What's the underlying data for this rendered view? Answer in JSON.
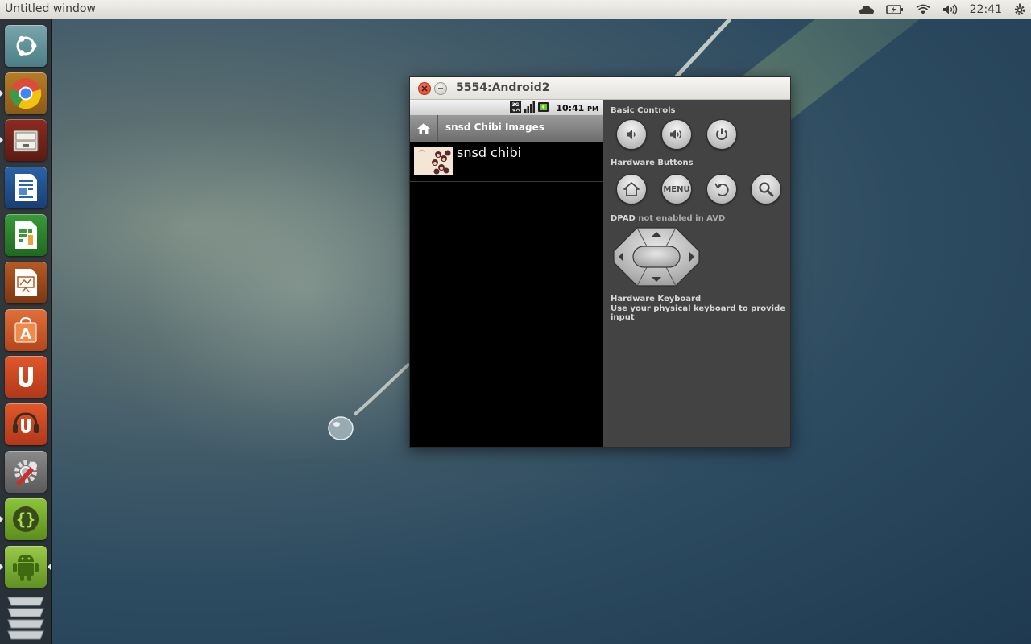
{
  "panel": {
    "window_title": "Untitled window",
    "clock": "22:41",
    "tray_icons": [
      "cloud-icon",
      "battery-icon",
      "wifi-icon",
      "volume-icon",
      "power-gear-icon"
    ]
  },
  "launcher": {
    "items": [
      {
        "name": "ubuntu-dash-icon"
      },
      {
        "name": "chrome-icon"
      },
      {
        "name": "file-manager-icon"
      },
      {
        "name": "writer-icon"
      },
      {
        "name": "calc-icon"
      },
      {
        "name": "impress-icon"
      },
      {
        "name": "software-center-icon"
      },
      {
        "name": "ubuntu-one-icon"
      },
      {
        "name": "ubuntu-one-music-icon"
      },
      {
        "name": "system-settings-icon"
      },
      {
        "name": "brackets-icon"
      },
      {
        "name": "android-icon"
      },
      {
        "name": "workspace-switcher-icon"
      }
    ]
  },
  "emulator": {
    "title": "5554:Android2",
    "android": {
      "status_time": "10:41",
      "status_ampm": "PM",
      "status_icons": [
        "3g-icon",
        "signal-icon",
        "battery-charging-icon"
      ],
      "app_title": "snsd Chibi Images",
      "list": [
        {
          "label": "snsd chibi"
        }
      ]
    },
    "controls": {
      "basic_label": "Basic Controls",
      "hardware_label": "Hardware Buttons",
      "menu_label": "MENU",
      "dpad_label": "DPAD",
      "dpad_note": "not enabled in AVD",
      "keyboard_title": "Hardware Keyboard",
      "keyboard_desc": "Use your physical keyboard to provide input"
    }
  }
}
